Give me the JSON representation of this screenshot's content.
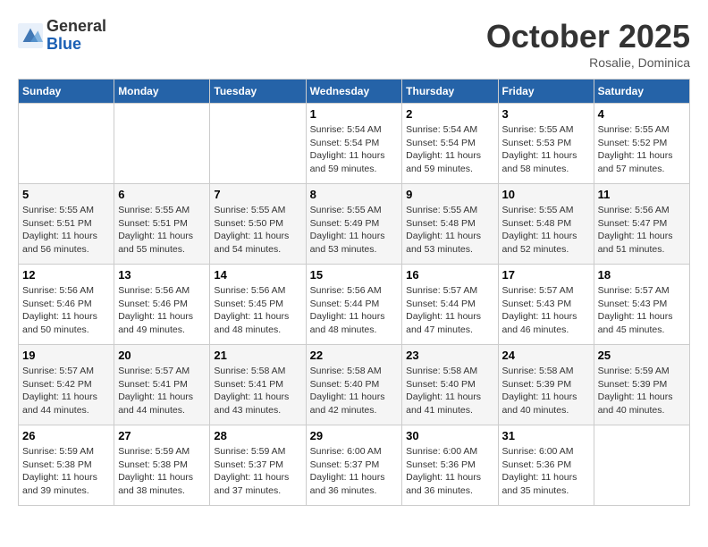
{
  "header": {
    "logo": {
      "general": "General",
      "blue": "Blue"
    },
    "title": "October 2025",
    "location": "Rosalie, Dominica"
  },
  "calendar": {
    "days_of_week": [
      "Sunday",
      "Monday",
      "Tuesday",
      "Wednesday",
      "Thursday",
      "Friday",
      "Saturday"
    ],
    "weeks": [
      [
        {
          "day": "",
          "info": ""
        },
        {
          "day": "",
          "info": ""
        },
        {
          "day": "",
          "info": ""
        },
        {
          "day": "1",
          "info": "Sunrise: 5:54 AM\nSunset: 5:54 PM\nDaylight: 11 hours and 59 minutes."
        },
        {
          "day": "2",
          "info": "Sunrise: 5:54 AM\nSunset: 5:54 PM\nDaylight: 11 hours and 59 minutes."
        },
        {
          "day": "3",
          "info": "Sunrise: 5:55 AM\nSunset: 5:53 PM\nDaylight: 11 hours and 58 minutes."
        },
        {
          "day": "4",
          "info": "Sunrise: 5:55 AM\nSunset: 5:52 PM\nDaylight: 11 hours and 57 minutes."
        }
      ],
      [
        {
          "day": "5",
          "info": "Sunrise: 5:55 AM\nSunset: 5:51 PM\nDaylight: 11 hours and 56 minutes."
        },
        {
          "day": "6",
          "info": "Sunrise: 5:55 AM\nSunset: 5:51 PM\nDaylight: 11 hours and 55 minutes."
        },
        {
          "day": "7",
          "info": "Sunrise: 5:55 AM\nSunset: 5:50 PM\nDaylight: 11 hours and 54 minutes."
        },
        {
          "day": "8",
          "info": "Sunrise: 5:55 AM\nSunset: 5:49 PM\nDaylight: 11 hours and 53 minutes."
        },
        {
          "day": "9",
          "info": "Sunrise: 5:55 AM\nSunset: 5:48 PM\nDaylight: 11 hours and 53 minutes."
        },
        {
          "day": "10",
          "info": "Sunrise: 5:55 AM\nSunset: 5:48 PM\nDaylight: 11 hours and 52 minutes."
        },
        {
          "day": "11",
          "info": "Sunrise: 5:56 AM\nSunset: 5:47 PM\nDaylight: 11 hours and 51 minutes."
        }
      ],
      [
        {
          "day": "12",
          "info": "Sunrise: 5:56 AM\nSunset: 5:46 PM\nDaylight: 11 hours and 50 minutes."
        },
        {
          "day": "13",
          "info": "Sunrise: 5:56 AM\nSunset: 5:46 PM\nDaylight: 11 hours and 49 minutes."
        },
        {
          "day": "14",
          "info": "Sunrise: 5:56 AM\nSunset: 5:45 PM\nDaylight: 11 hours and 48 minutes."
        },
        {
          "day": "15",
          "info": "Sunrise: 5:56 AM\nSunset: 5:44 PM\nDaylight: 11 hours and 48 minutes."
        },
        {
          "day": "16",
          "info": "Sunrise: 5:57 AM\nSunset: 5:44 PM\nDaylight: 11 hours and 47 minutes."
        },
        {
          "day": "17",
          "info": "Sunrise: 5:57 AM\nSunset: 5:43 PM\nDaylight: 11 hours and 46 minutes."
        },
        {
          "day": "18",
          "info": "Sunrise: 5:57 AM\nSunset: 5:43 PM\nDaylight: 11 hours and 45 minutes."
        }
      ],
      [
        {
          "day": "19",
          "info": "Sunrise: 5:57 AM\nSunset: 5:42 PM\nDaylight: 11 hours and 44 minutes."
        },
        {
          "day": "20",
          "info": "Sunrise: 5:57 AM\nSunset: 5:41 PM\nDaylight: 11 hours and 44 minutes."
        },
        {
          "day": "21",
          "info": "Sunrise: 5:58 AM\nSunset: 5:41 PM\nDaylight: 11 hours and 43 minutes."
        },
        {
          "day": "22",
          "info": "Sunrise: 5:58 AM\nSunset: 5:40 PM\nDaylight: 11 hours and 42 minutes."
        },
        {
          "day": "23",
          "info": "Sunrise: 5:58 AM\nSunset: 5:40 PM\nDaylight: 11 hours and 41 minutes."
        },
        {
          "day": "24",
          "info": "Sunrise: 5:58 AM\nSunset: 5:39 PM\nDaylight: 11 hours and 40 minutes."
        },
        {
          "day": "25",
          "info": "Sunrise: 5:59 AM\nSunset: 5:39 PM\nDaylight: 11 hours and 40 minutes."
        }
      ],
      [
        {
          "day": "26",
          "info": "Sunrise: 5:59 AM\nSunset: 5:38 PM\nDaylight: 11 hours and 39 minutes."
        },
        {
          "day": "27",
          "info": "Sunrise: 5:59 AM\nSunset: 5:38 PM\nDaylight: 11 hours and 38 minutes."
        },
        {
          "day": "28",
          "info": "Sunrise: 5:59 AM\nSunset: 5:37 PM\nDaylight: 11 hours and 37 minutes."
        },
        {
          "day": "29",
          "info": "Sunrise: 6:00 AM\nSunset: 5:37 PM\nDaylight: 11 hours and 36 minutes."
        },
        {
          "day": "30",
          "info": "Sunrise: 6:00 AM\nSunset: 5:36 PM\nDaylight: 11 hours and 36 minutes."
        },
        {
          "day": "31",
          "info": "Sunrise: 6:00 AM\nSunset: 5:36 PM\nDaylight: 11 hours and 35 minutes."
        },
        {
          "day": "",
          "info": ""
        }
      ]
    ]
  }
}
